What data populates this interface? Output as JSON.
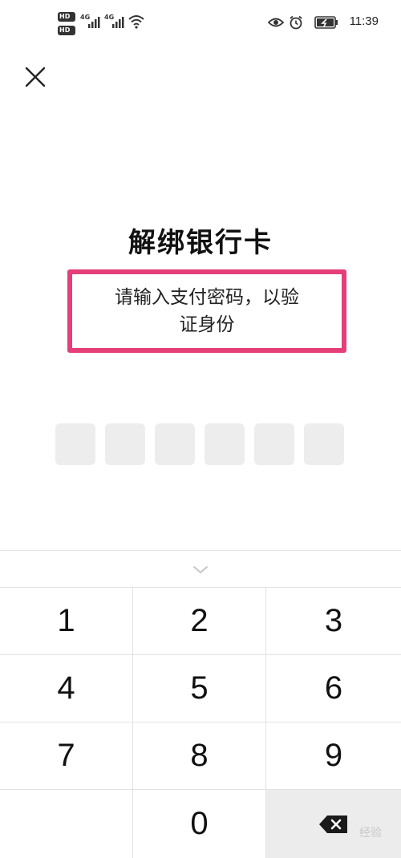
{
  "status_bar": {
    "sim1_badge": "HD",
    "sim2_badge": "HD",
    "sim1_network": "4G",
    "sim2_network": "4G",
    "icons": [
      "signal-icon",
      "wifi-icon",
      "eye-icon",
      "alarm-icon",
      "battery-icon"
    ],
    "time": "11:39"
  },
  "header": {
    "close_icon": "close-icon"
  },
  "main": {
    "title": "解绑银行卡",
    "subtitle_line1": "请输入支付密码，以验",
    "subtitle_line2": "证身份",
    "highlight_color": "#e53e79",
    "pin_length": 6
  },
  "keyboard": {
    "collapse_icon": "chevron-down-icon",
    "keys": [
      "1",
      "2",
      "3",
      "4",
      "5",
      "6",
      "7",
      "8",
      "9",
      "",
      "0",
      "backspace"
    ],
    "backspace_icon": "backspace-icon"
  },
  "watermark": "经验"
}
